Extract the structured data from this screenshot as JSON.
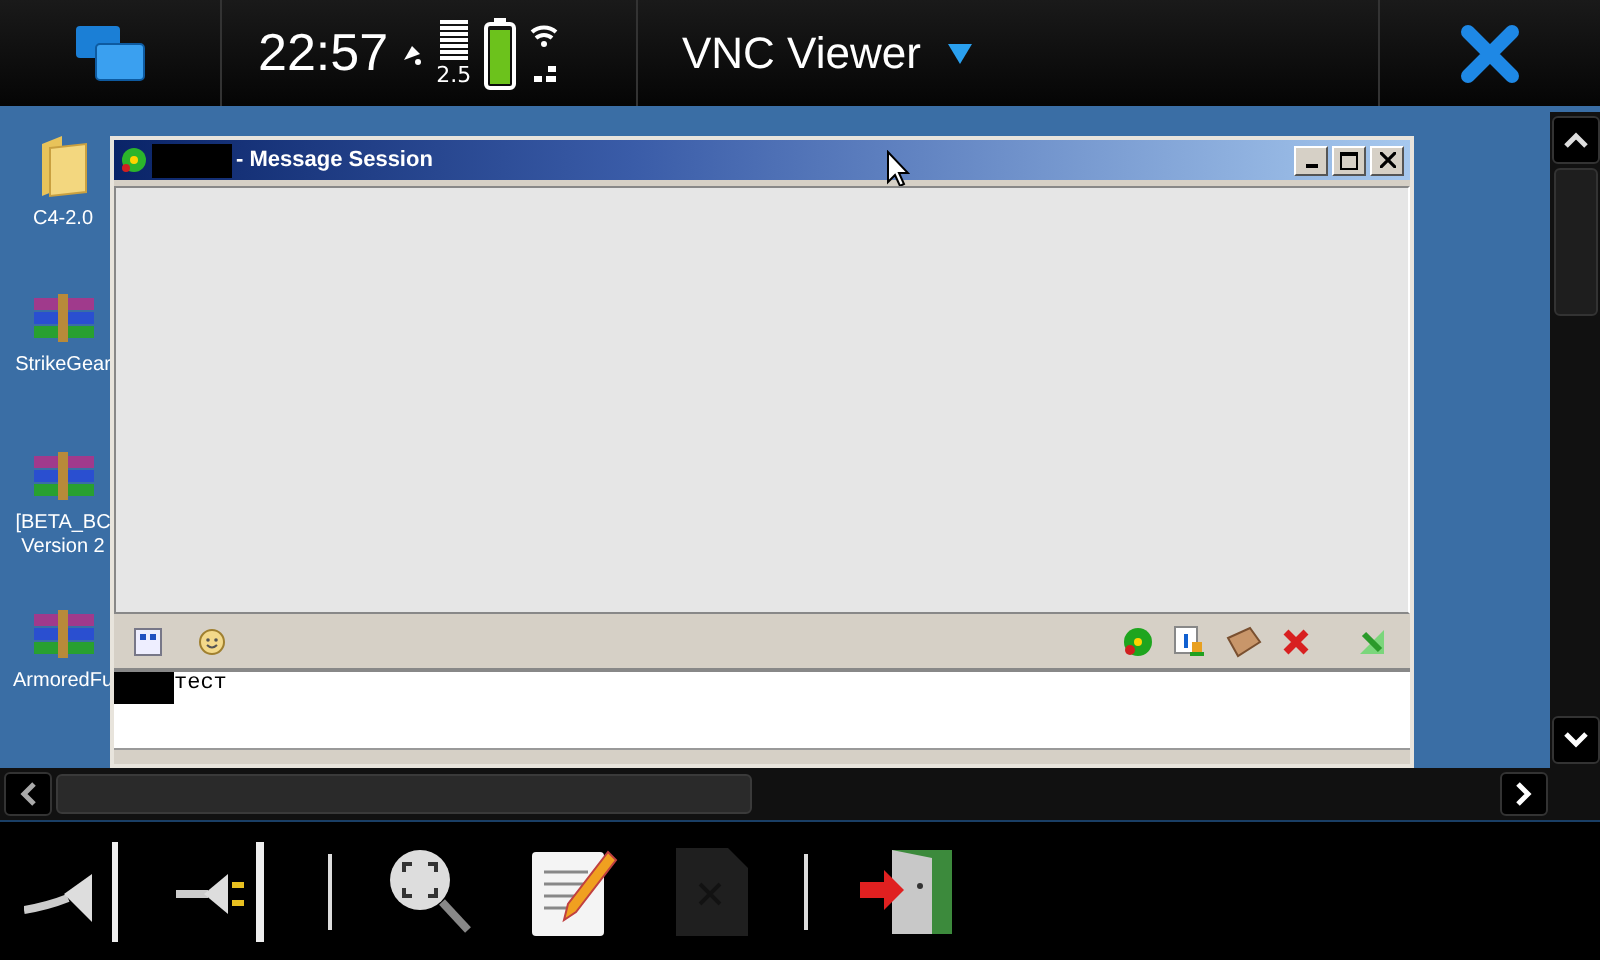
{
  "status_bar": {
    "time": "22:57",
    "network_label": "2.5",
    "app_title": "VNC Viewer"
  },
  "desktop_icons": [
    {
      "kind": "folder",
      "label": "C4-2.0"
    },
    {
      "kind": "archive",
      "label": "StrikeGear"
    },
    {
      "kind": "archive",
      "label": "[BETA_BC\nVersion 2"
    },
    {
      "kind": "archive",
      "label": "ArmoredFu"
    }
  ],
  "window": {
    "title": "- Message Session",
    "input_value": "тест"
  },
  "toolbar": [
    {
      "kind": "plug-out",
      "disabled": false
    },
    {
      "kind": "plug-in",
      "disabled": false
    },
    {
      "kind": "separator"
    },
    {
      "kind": "zoom",
      "disabled": false
    },
    {
      "kind": "edit",
      "disabled": false
    },
    {
      "kind": "document",
      "disabled": true
    },
    {
      "kind": "separator"
    },
    {
      "kind": "exit",
      "disabled": false
    }
  ]
}
